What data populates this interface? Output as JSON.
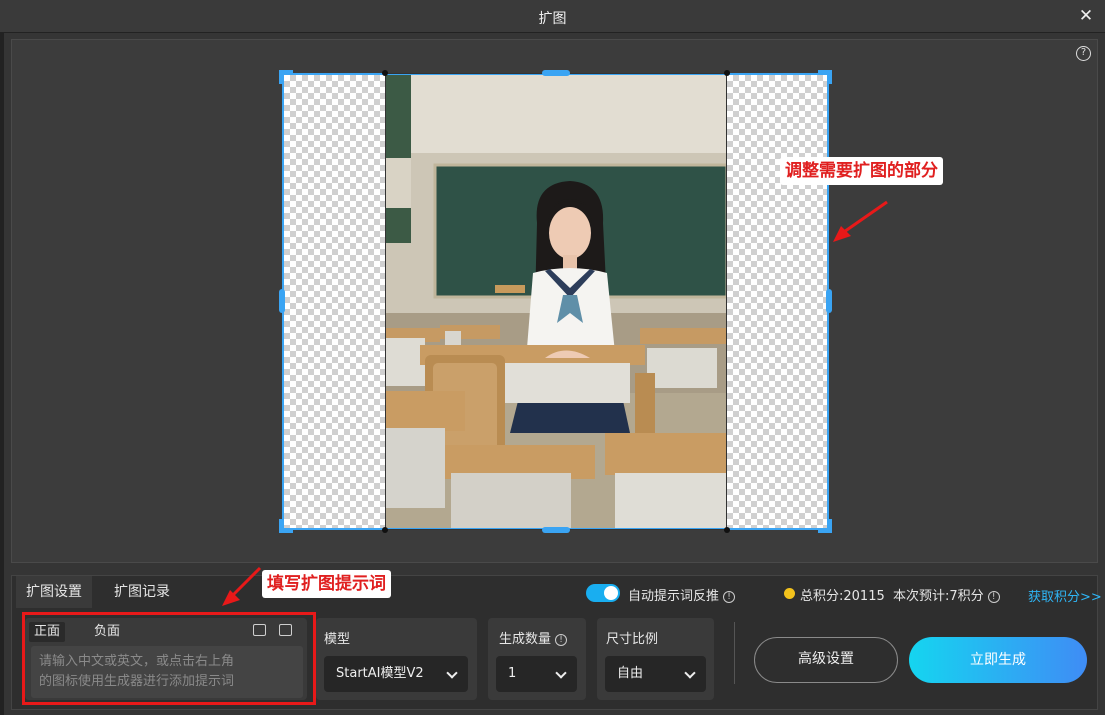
{
  "window": {
    "title": "扩图",
    "close_icon": "close-icon"
  },
  "canvas": {
    "help_icon": "help-icon",
    "help_symbol": "?"
  },
  "annotations": {
    "adjust": "调整需要扩图的部分",
    "prompt": "填写扩图提示词",
    "color": "#e02020"
  },
  "panel": {
    "tabs": [
      "扩图设置",
      "扩图记录"
    ],
    "auto_prompt_label": "自动提示词反推",
    "auto_prompt_on": true,
    "total_points": "总积分:20115",
    "estimate": "本次预计:7积分",
    "get_points": "获取积分>>",
    "prompt": {
      "tabs": [
        "正面",
        "负面"
      ],
      "placeholder_line1": "请输入中文或英文，或点击右上角",
      "placeholder_line2": "的图标使用生成器进行添加提示词"
    },
    "model": {
      "label": "模型",
      "value": "StartAI模型V2"
    },
    "count": {
      "label": "生成数量",
      "value": "1"
    },
    "ratio": {
      "label": "尺寸比例",
      "value": "自由"
    },
    "advanced_button": "高级设置",
    "generate_button": "立即生成",
    "accent_color": "#19aef0",
    "selection_color": "#3aa4f3"
  }
}
